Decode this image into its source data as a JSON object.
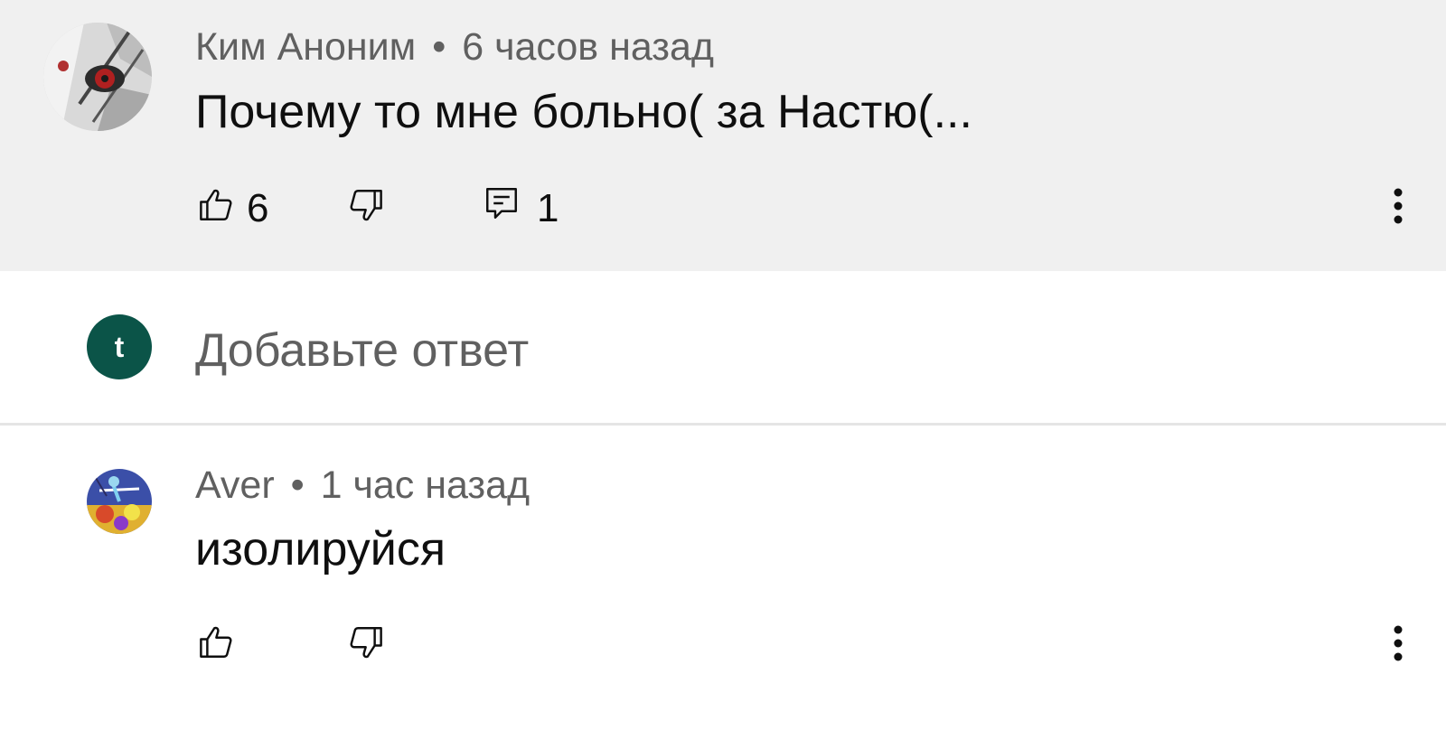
{
  "main_comment": {
    "author": "Ким Аноним",
    "separator": "•",
    "time": "6 часов назад",
    "text": "Почему то мне больно( за Настю(...",
    "likes": "6",
    "replies": "1",
    "avatar_icon": "anime-eye-avatar"
  },
  "reply_box": {
    "placeholder": "Добавьте ответ",
    "avatar_letter": "t",
    "avatar_color": "#0b5448"
  },
  "reply_comment": {
    "author": "Aver",
    "separator": "•",
    "time": "1 час назад",
    "text": "изолируйся",
    "avatar_icon": "cartoon-avatar"
  },
  "colors": {
    "highlight_bg": "#f0f0f0",
    "meta_text": "#606060",
    "body_text": "#0f0f0f"
  },
  "icons": {
    "like": "thumb-up-icon",
    "dislike": "thumb-down-icon",
    "reply": "comment-icon",
    "more": "more-vert-icon"
  }
}
